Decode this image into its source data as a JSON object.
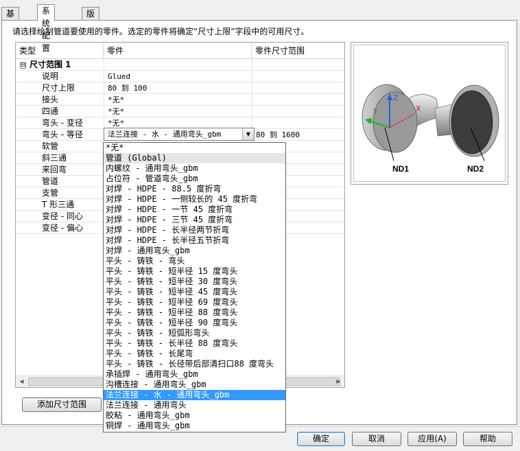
{
  "tabs": [
    {
      "label": "基本"
    },
    {
      "label": "系统配置"
    },
    {
      "label": "版本历史"
    }
  ],
  "instruction": "请选择绘制管道要使用的零件。选定的零件将确定“尺寸上限”字段中的可用尺寸。",
  "grid": {
    "headers": [
      "类型",
      "零件",
      "零件尺寸范围"
    ],
    "group_label": "尺寸范围 1",
    "expander": "⊟",
    "rows": [
      {
        "type": "说明",
        "part": "Glued",
        "range": ""
      },
      {
        "type": "尺寸上限",
        "part": "80 到 100",
        "range": ""
      },
      {
        "type": "接头",
        "part": "*无*",
        "range": ""
      },
      {
        "type": "四通",
        "part": "*无*",
        "range": ""
      },
      {
        "type": "弯头 - 变径",
        "part": "*无*",
        "range": ""
      },
      {
        "type": "弯头 - 等径",
        "part": "",
        "range": "80 到 1600"
      },
      {
        "type": "软管",
        "part": "",
        "range": ""
      },
      {
        "type": "斜三通",
        "part": "",
        "range": ""
      },
      {
        "type": "来回弯",
        "part": "",
        "range": ""
      },
      {
        "type": "管道",
        "part": "",
        "range": ""
      },
      {
        "type": "支管",
        "part": "",
        "range": ""
      },
      {
        "type": "T 形三通",
        "part": "",
        "range": ""
      },
      {
        "type": "变径 - 同心",
        "part": "",
        "range": ""
      },
      {
        "type": "变径 - 偏心",
        "part": "",
        "range": ""
      }
    ],
    "combo_value": "法兰连接 - 水 - 通用弯头_gbm"
  },
  "dropdown": {
    "items": [
      "*无*",
      "管道 (Global)",
      "内螺纹 - 通用弯头_gbm",
      "占位符 - 管道弯头_gbm",
      "对焊 - HDPE - 88.5 度折弯",
      "对焊 - HDPE - 一侧较长的 45 度折弯",
      "对焊 - HDPE - 一节 45 度折弯",
      "对焊 - HDPE - 三节 45 度折弯",
      "对焊 - HDPE - 长半径两节折弯",
      "对焊 - HDPE - 长半径五节折弯",
      "对焊 - 通用弯头_gbm",
      "平头 - 铸铁 - 弯头",
      "平头 - 铸铁 - 短半径 15 度弯头",
      "平头 - 铸铁 - 短半径 30 度弯头",
      "平头 - 铸铁 - 短半径 45 度弯头",
      "平头 - 铸铁 - 短半径 69 度弯头",
      "平头 - 铸铁 - 短半径 88 度弯头",
      "平头 - 铸铁 - 短半径 90 度弯头",
      "平头 - 铸铁 - 短弧形弯头",
      "平头 - 铸铁 - 长半径 88 度弯头",
      "平头 - 铸铁 - 长尾弯",
      "平头 - 铸铁 - 长径带后部清扫口88 度弯头",
      "承插焊 - 通用弯头_gbm",
      "沟槽连接 - 通用弯头_gbm",
      "法兰连接 - 水 - 通用弯头_gbm",
      "法兰连接 - 通用弯头",
      "胶粘 - 通用弯头_gbm",
      "铜焊 - 通用弯头_gbm"
    ],
    "hover_index": 1,
    "selected_index": 24
  },
  "preview": {
    "label_nd1": "ND1",
    "label_nd2": "ND2",
    "axis_x": "X",
    "axis_y": "Y",
    "axis_z": "Z"
  },
  "buttons": {
    "add_range": "添加尺寸范围",
    "ok": "确定",
    "cancel": "取消",
    "apply": "应用(A)",
    "help": "帮助"
  },
  "colors": {
    "selection": "#3399ff",
    "axis_x": "#e02020",
    "axis_y": "#20b020",
    "axis_z": "#2060e0"
  },
  "icons": {
    "combo_arrow": "▼",
    "scroll_left": "◀",
    "scroll_right": "▶"
  }
}
